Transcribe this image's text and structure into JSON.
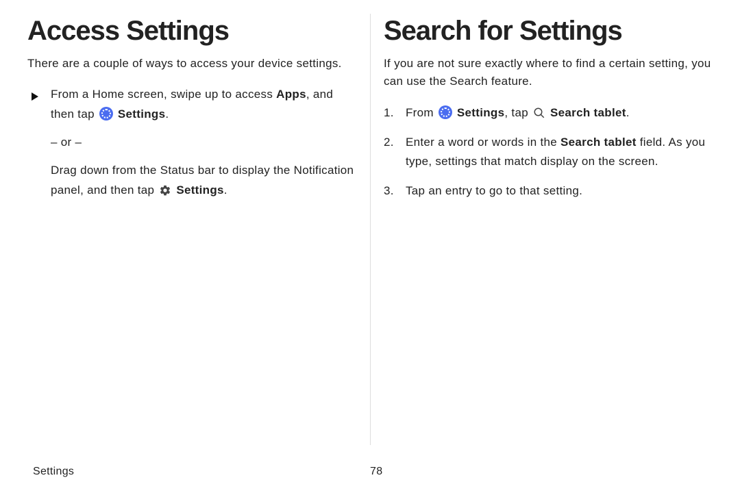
{
  "left": {
    "heading": "Access Settings",
    "intro": "There are a couple of ways to access your device settings.",
    "bullet": {
      "line1_a": "From a Home screen, swipe up to access ",
      "line1_bold1": "Apps",
      "line1_b": ", and then tap ",
      "line1_bold2": " Settings",
      "line1_c": ".",
      "or": "– or –",
      "line2_a": "Drag down from the Status bar to display the Notification panel, and then tap ",
      "line2_bold": " Settings",
      "line2_b": "."
    }
  },
  "right": {
    "heading": "Search for Settings",
    "intro": "If you are not sure exactly where to find a certain setting, you can use the Search feature.",
    "steps": {
      "s1_a": "From ",
      "s1_bold1": " Settings",
      "s1_b": ", tap ",
      "s1_bold2": " Search tablet",
      "s1_c": ".",
      "s2_a": "Enter a word or words in the ",
      "s2_bold": "Search tablet",
      "s2_b": " field. As you type, settings that match display on the screen.",
      "s3": "Tap an entry to go to that setting."
    }
  },
  "footer": {
    "section": "Settings",
    "page": "78"
  }
}
